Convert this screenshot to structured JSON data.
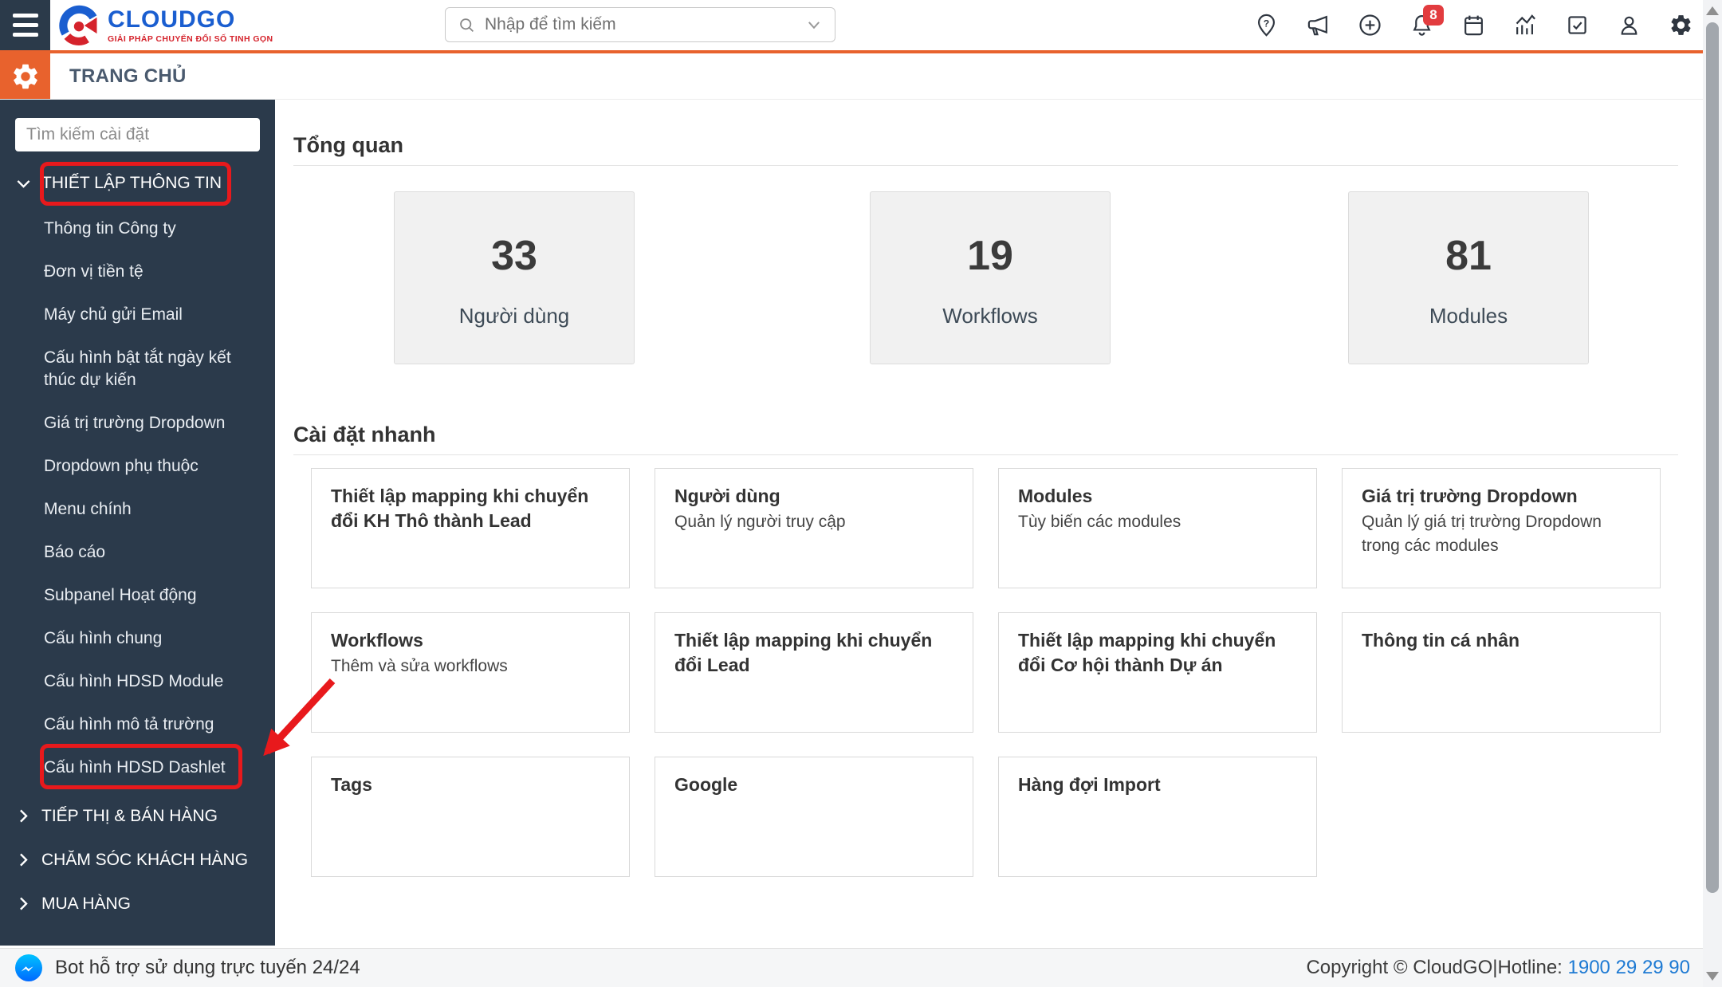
{
  "header": {
    "logo": {
      "brand": "CLOUDGO",
      "tagline": "GIẢI PHÁP CHUYỂN ĐỔI SỐ TINH GỌN"
    },
    "search": {
      "placeholder": "Nhập để tìm kiếm"
    },
    "notification_badge": "8",
    "icons": [
      "location-help",
      "announcements",
      "quick-add",
      "notifications",
      "calendar",
      "analytics",
      "tasks",
      "profile",
      "settings"
    ]
  },
  "module_bar": {
    "title": "TRANG CHỦ"
  },
  "sidebar": {
    "search_placeholder": "Tìm kiếm cài đặt",
    "sections": [
      {
        "label": "THIẾT LẬP THÔNG TIN",
        "expanded": true,
        "items": [
          "Thông tin Công ty",
          "Đơn vị tiền tệ",
          "Máy chủ gửi Email",
          "Cấu hình bật tắt ngày kết thúc dự kiến",
          "Giá trị trường Dropdown",
          "Dropdown phụ thuộc",
          "Menu chính",
          "Báo cáo",
          "Subpanel Hoạt động",
          "Cấu hình chung",
          "Cấu hình HDSD Module",
          "Cấu hình mô tả trường",
          "Cấu hình HDSD Dashlet"
        ]
      },
      {
        "label": "TIẾP THỊ & BÁN HÀNG",
        "expanded": false
      },
      {
        "label": "CHĂM SÓC KHÁCH HÀNG",
        "expanded": false
      },
      {
        "label": "MUA HÀNG",
        "expanded": false
      }
    ]
  },
  "main": {
    "overview": {
      "title": "Tổng quan",
      "stats": [
        {
          "value": "33",
          "label": "Người dùng"
        },
        {
          "value": "19",
          "label": "Workflows"
        },
        {
          "value": "81",
          "label": "Modules"
        }
      ]
    },
    "quick_settings": {
      "title": "Cài đặt nhanh",
      "cards": [
        {
          "title": "Thiết lập mapping khi chuyển đổi KH Thô thành Lead",
          "subtitle": ""
        },
        {
          "title": "Người dùng",
          "subtitle": "Quản lý người truy cập"
        },
        {
          "title": "Modules",
          "subtitle": "Tùy biến các modules"
        },
        {
          "title": "Giá trị trường Dropdown",
          "subtitle": "Quản lý giá trị trường Dropdown trong các modules"
        },
        {
          "title": "Workflows",
          "subtitle": "Thêm và sửa workflows"
        },
        {
          "title": "Thiết lập mapping khi chuyển đổi Lead",
          "subtitle": ""
        },
        {
          "title": "Thiết lập mapping khi chuyển đổi Cơ hội thành Dự án",
          "subtitle": ""
        },
        {
          "title": "Thông tin cá nhân",
          "subtitle": ""
        },
        {
          "title": "Tags",
          "subtitle": ""
        },
        {
          "title": "Google",
          "subtitle": ""
        },
        {
          "title": "Hàng đợi Import",
          "subtitle": ""
        }
      ]
    }
  },
  "footer": {
    "bot_text": "Bot hỗ trợ sử dụng trực tuyến 24/24",
    "copyright": "Copyright © CloudGO",
    "separator": "|",
    "hotline_label": "Hotline: ",
    "hotline_number": "1900 29 29 90"
  },
  "colors": {
    "accent_orange": "#e8622d",
    "sidebar_bg": "#2b3a4b",
    "annotation_red": "#e8191c",
    "badge_red": "#e23c3f",
    "hotline_blue": "#1e7ad3",
    "logo_blue": "#1a5ed0",
    "logo_red": "#d5232c",
    "messenger_blue": "#0084ff",
    "stat_card_bg": "#f1f1f1"
  }
}
